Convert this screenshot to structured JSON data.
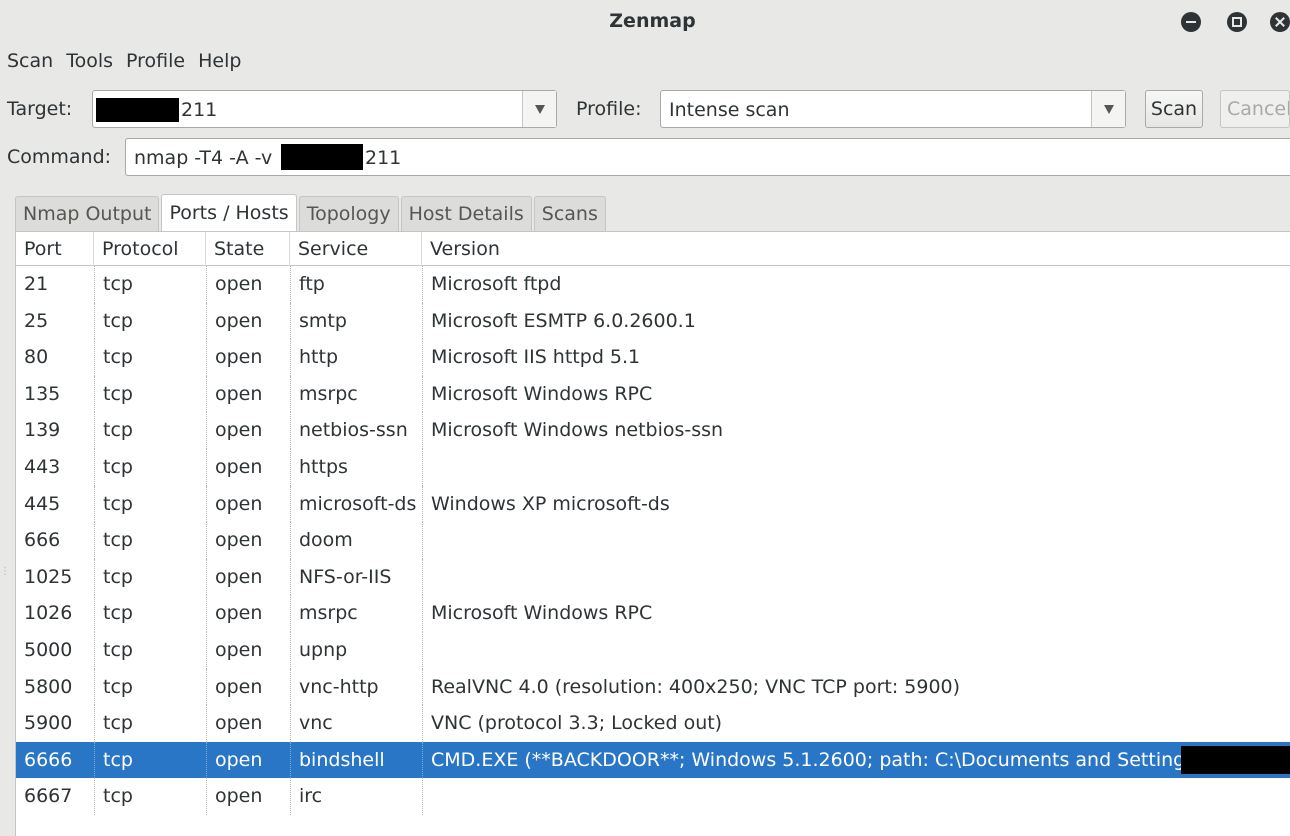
{
  "window": {
    "title": "Zenmap"
  },
  "menu": [
    "Scan",
    "Tools",
    "Profile",
    "Help"
  ],
  "target": {
    "label": "Target:",
    "value": "211"
  },
  "profile": {
    "label": "Profile:",
    "value": "Intense scan"
  },
  "buttons": {
    "scan": "Scan",
    "cancel": "Cancel"
  },
  "command": {
    "label": "Command:",
    "prefix": "nmap -T4 -A -v ",
    "suffix": "211"
  },
  "tabs": [
    "Nmap Output",
    "Ports / Hosts",
    "Topology",
    "Host Details",
    "Scans"
  ],
  "active_tab": "Ports / Hosts",
  "columns": [
    "Port",
    "Protocol",
    "State",
    "Service",
    "Version"
  ],
  "rows": [
    [
      "21",
      "tcp",
      "open",
      "ftp",
      "Microsoft ftpd"
    ],
    [
      "25",
      "tcp",
      "open",
      "smtp",
      "Microsoft ESMTP 6.0.2600.1"
    ],
    [
      "80",
      "tcp",
      "open",
      "http",
      "Microsoft IIS httpd 5.1"
    ],
    [
      "135",
      "tcp",
      "open",
      "msrpc",
      "Microsoft Windows RPC"
    ],
    [
      "139",
      "tcp",
      "open",
      "netbios-ssn",
      "Microsoft Windows netbios-ssn"
    ],
    [
      "443",
      "tcp",
      "open",
      "https",
      ""
    ],
    [
      "445",
      "tcp",
      "open",
      "microsoft-ds",
      "Windows XP microsoft-ds"
    ],
    [
      "666",
      "tcp",
      "open",
      "doom",
      ""
    ],
    [
      "1025",
      "tcp",
      "open",
      "NFS-or-IIS",
      ""
    ],
    [
      "1026",
      "tcp",
      "open",
      "msrpc",
      "Microsoft Windows RPC"
    ],
    [
      "5000",
      "tcp",
      "open",
      "upnp",
      ""
    ],
    [
      "5800",
      "tcp",
      "open",
      "vnc-http",
      "RealVNC 4.0 (resolution: 400x250; VNC TCP port: 5900)"
    ],
    [
      "5900",
      "tcp",
      "open",
      "vnc",
      "VNC (protocol 3.3; Locked out)"
    ],
    [
      "6666",
      "tcp",
      "open",
      "bindshell",
      "CMD.EXE (**BACKDOOR**; Windows 5.1.2600; path: C:\\Documents and Settings\\"
    ],
    [
      "6667",
      "tcp",
      "open",
      "irc",
      ""
    ]
  ],
  "selected_row_port": "6666",
  "colors": {
    "selection": "#2a76c6",
    "window_bg": "#e8e8e7"
  }
}
